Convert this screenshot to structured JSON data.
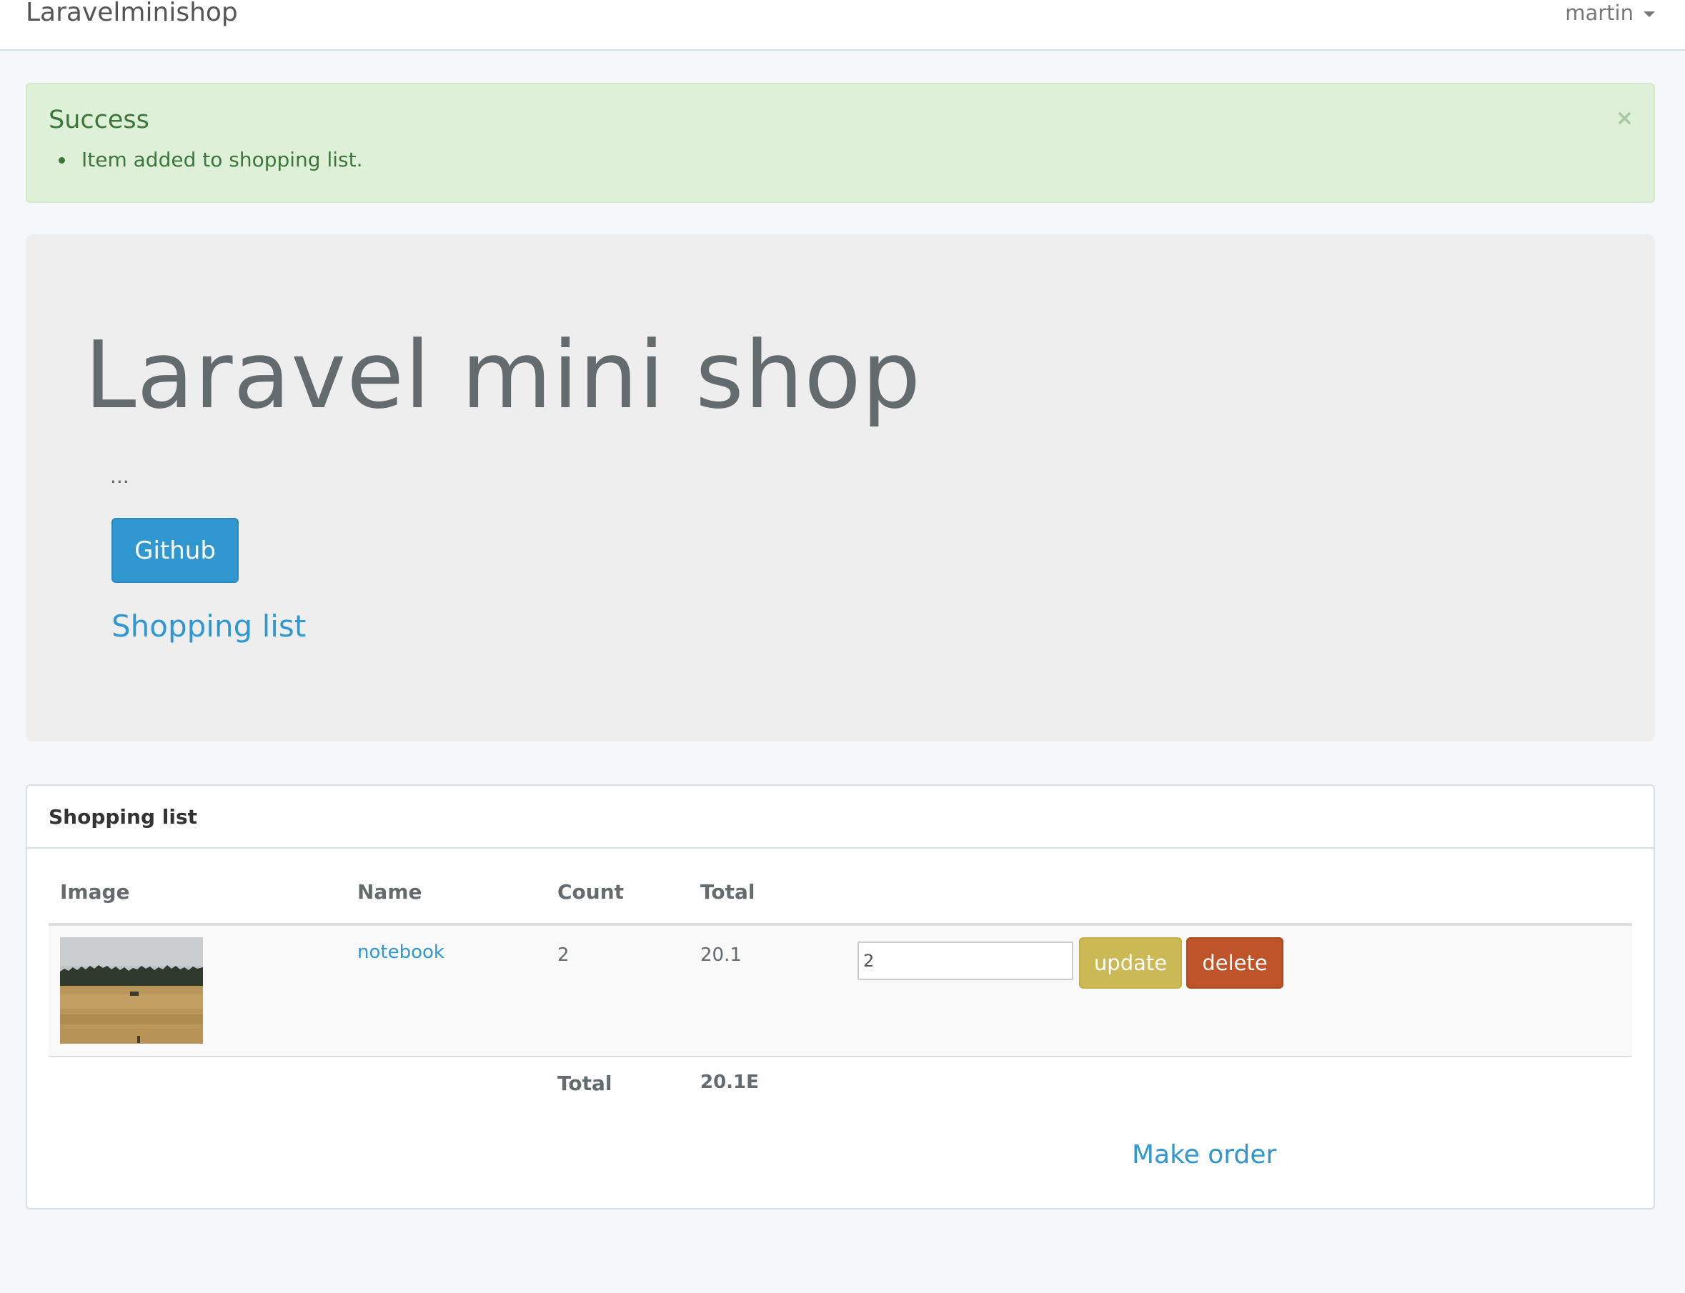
{
  "navbar": {
    "brand": "Laravelminishop",
    "user": "martin"
  },
  "alert": {
    "title": "Success",
    "messages": [
      "Item added to shopping list."
    ],
    "close": "×"
  },
  "jumbotron": {
    "title": "Laravel mini shop",
    "text": "...",
    "github_label": "Github",
    "shopping_link": "Shopping list"
  },
  "panel": {
    "heading": "Shopping list",
    "columns": [
      "Image",
      "Name",
      "Count",
      "Total"
    ],
    "items": [
      {
        "name": "notebook",
        "count": "2",
        "total": "20.1",
        "qty_value": "2",
        "update_label": "update",
        "delete_label": "delete"
      }
    ],
    "total_label": "Total",
    "total_value": "20.1E",
    "make_order": "Make order"
  },
  "colors": {
    "primary": "#3097d1",
    "warning": "#cbb956",
    "danger": "#bf5329",
    "success_bg": "#dff0d8"
  }
}
